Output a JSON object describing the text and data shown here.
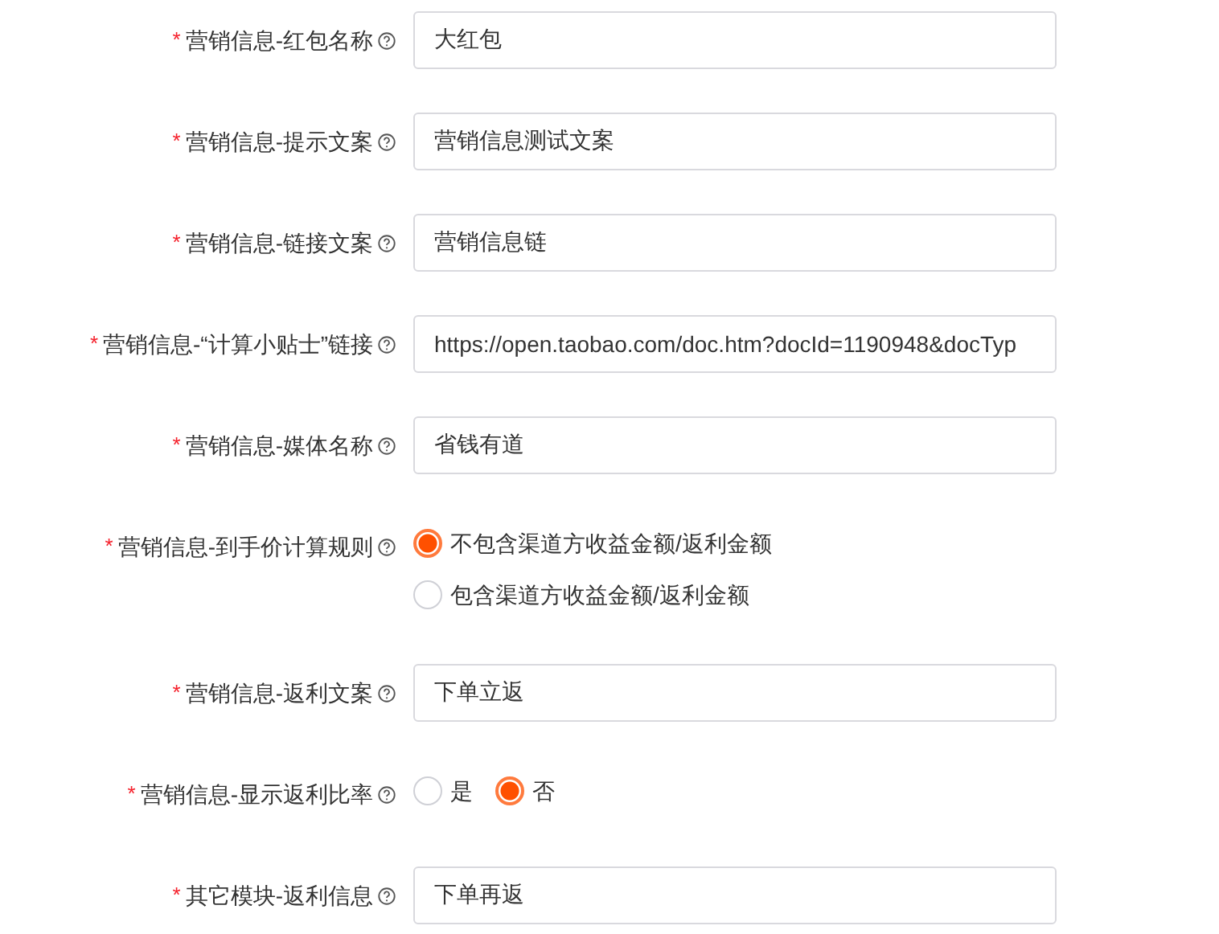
{
  "fields": [
    {
      "kind": "text",
      "label": "营销信息-红包名称",
      "required_mark": "*",
      "value": "大红包"
    },
    {
      "kind": "text",
      "label": "营销信息-提示文案",
      "required_mark": "*",
      "value": "营销信息测试文案"
    },
    {
      "kind": "text",
      "label": "营销信息-链接文案",
      "required_mark": "*",
      "value": "营销信息链"
    },
    {
      "kind": "text",
      "label": "营销信息-“计算小贴士”链接",
      "required_mark": "*",
      "value": "https://open.taobao.com/doc.htm?docId=1190948&docTyp"
    },
    {
      "kind": "text",
      "label": "营销信息-媒体名称",
      "required_mark": "*",
      "value": "省钱有道"
    },
    {
      "kind": "radio",
      "label": "营销信息-到手价计算规则",
      "required_mark": "*",
      "options": [
        {
          "label": "不包含渠道方收益金额/返利金额",
          "selected": true
        },
        {
          "label": "包含渠道方收益金额/返利金额",
          "selected": false
        }
      ]
    },
    {
      "kind": "text",
      "label": "营销信息-返利文案",
      "required_mark": "*",
      "value": "下单立返"
    },
    {
      "kind": "radio",
      "label": "营销信息-显示返利比率",
      "required_mark": "*",
      "options": [
        {
          "label": "是",
          "selected": false
        },
        {
          "label": "否",
          "selected": true
        }
      ]
    },
    {
      "kind": "text",
      "label": "其它模块-返利信息",
      "required_mark": "*",
      "value": "下单再返"
    }
  ]
}
